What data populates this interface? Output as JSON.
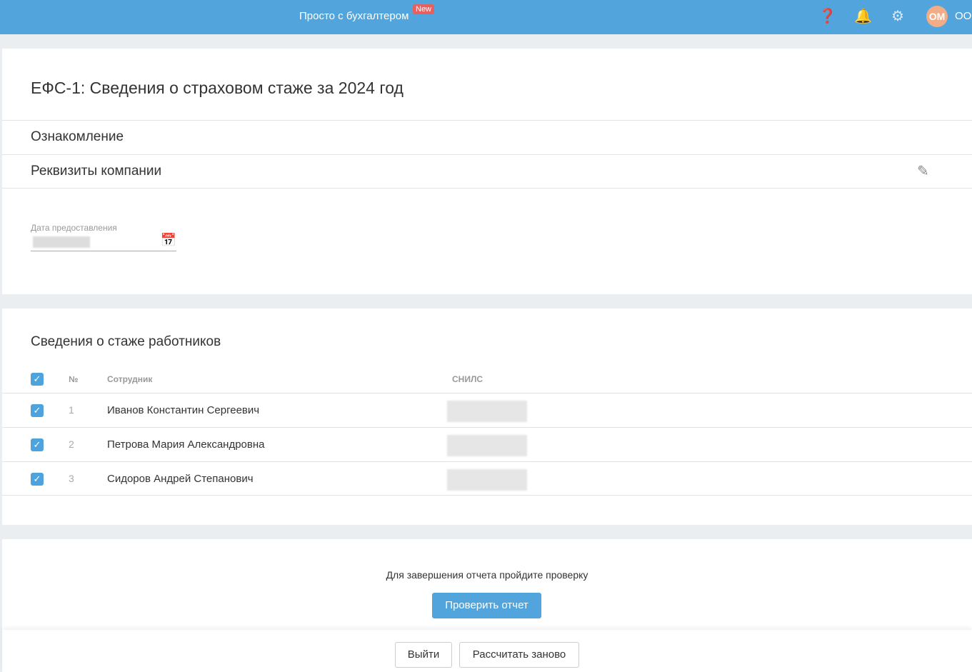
{
  "header": {
    "brand": "Просто с бухгалтером",
    "badge": "New",
    "avatar": "ОМ",
    "org": "ООО"
  },
  "page": {
    "title": "ЕФС-1: Сведения о страховом стаже за 2024 год",
    "sections": [
      "Ознакомление",
      "Реквизиты компании"
    ],
    "date_label": "Дата предоставления"
  },
  "employees": {
    "title": "Сведения о стаже работников",
    "columns": [
      "№",
      "Сотрудник",
      "СНИЛС"
    ],
    "rows": [
      {
        "n": "1",
        "name": "Иванов Константин Сергеевич"
      },
      {
        "n": "2",
        "name": "Петрова Мария Александровна"
      },
      {
        "n": "3",
        "name": "Сидоров Андрей Степанович"
      }
    ]
  },
  "check": {
    "text": "Для завершения отчета пройдите проверку",
    "button": "Проверить отчет"
  },
  "footer": {
    "exit": "Выйти",
    "recalc": "Рассчитать заново"
  }
}
